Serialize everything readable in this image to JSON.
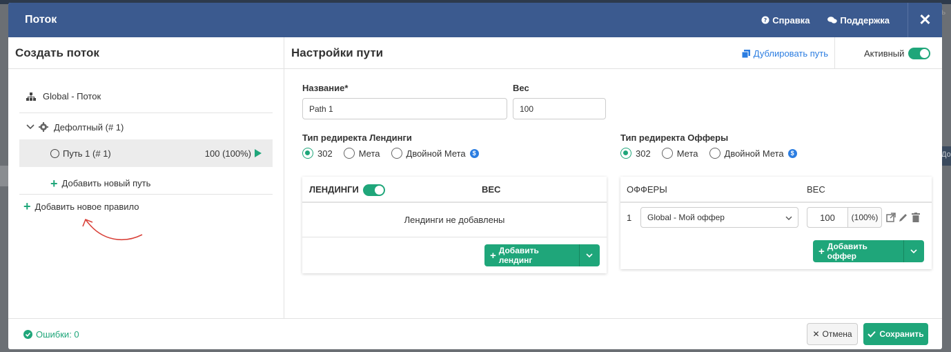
{
  "background": {
    "right_char": "ь",
    "right_col_text": "До"
  },
  "header": {
    "title": "Поток",
    "help_label": "Справка",
    "support_label": "Поддержка",
    "close_glyph": "✕"
  },
  "left": {
    "title": "Создать поток",
    "root_label": "Global - Поток",
    "rule_label": "Дефолтный (# 1)",
    "path_label": "Путь 1 (# 1)",
    "path_weight": "100 (100%)",
    "add_path_label": "Добавить новый путь",
    "add_rule_label": "Добавить новое правило"
  },
  "right": {
    "title": "Настройки пути",
    "duplicate_label": "Дублировать путь",
    "active_label": "Активный",
    "name_label": "Название*",
    "name_value": "Path 1",
    "weight_label": "Вес",
    "weight_value": "100",
    "landing_redirect_label": "Тип редиректа Лендинги",
    "offer_redirect_label": "Тип редиректа Офферы",
    "redirect_options": [
      "302",
      "Мета",
      "Двойной Мета"
    ],
    "landing_selected": "302",
    "offer_selected": "302"
  },
  "landings": {
    "header": "ЛЕНДИНГИ",
    "weight_header": "ВЕС",
    "empty_text": "Лендинги не добавлены",
    "add_label": "Добавить лендинг",
    "enabled": true
  },
  "offers": {
    "header": "ОФФЕРЫ",
    "weight_header": "ВЕС",
    "rows": [
      {
        "index": "1",
        "offer": "Global - Мой оффер",
        "weight": "100",
        "percent": "(100%)"
      }
    ],
    "add_label": "Добавить оффер"
  },
  "footer": {
    "errors_label": "Ошибки: 0",
    "cancel_label": "Отмена",
    "save_label": "Сохранить"
  },
  "colors": {
    "header_bg": "#3b5a8f",
    "accent": "#1fa67a",
    "link": "#2b7de1",
    "arrow": "#d9423a"
  }
}
